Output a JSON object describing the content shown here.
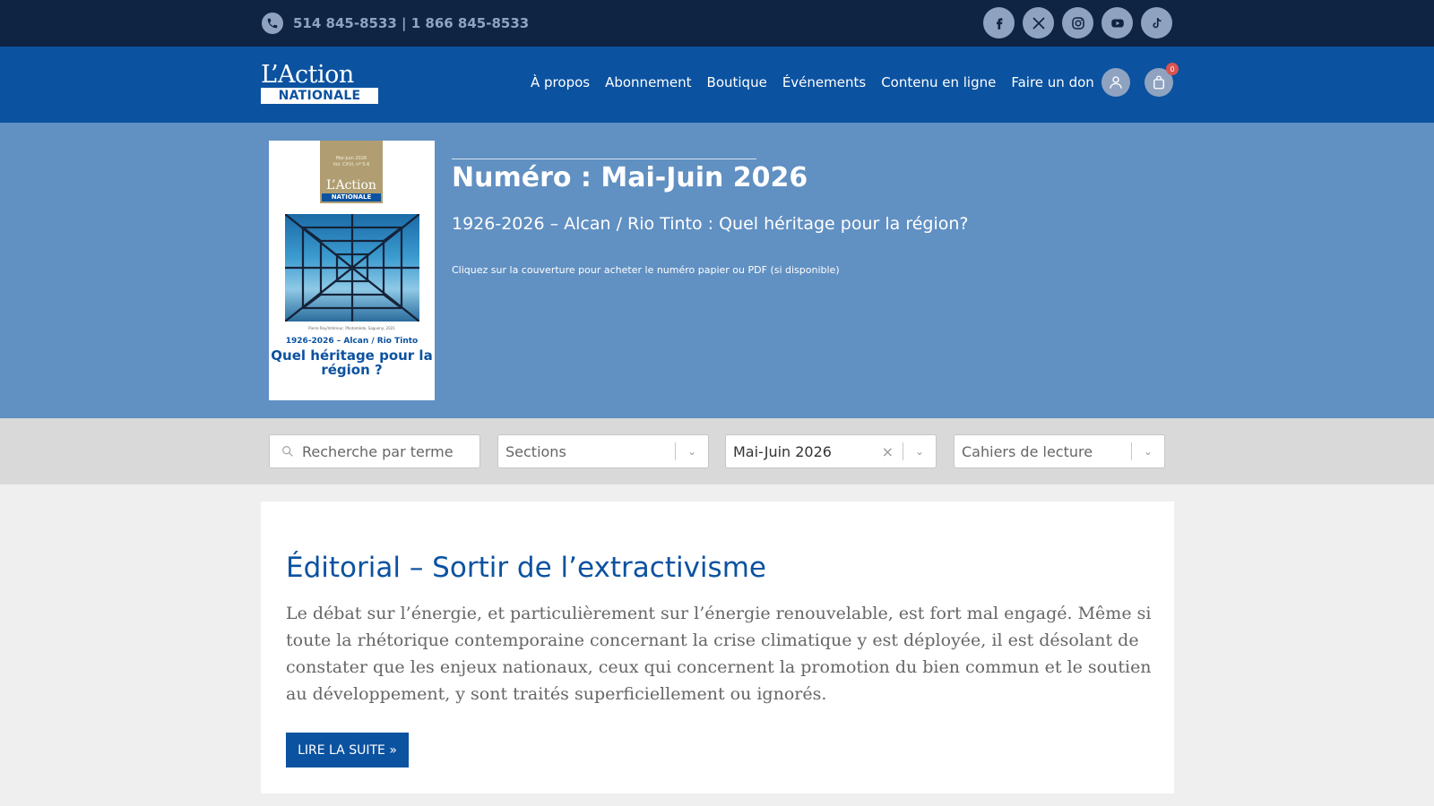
{
  "topbar": {
    "phone_text": "514 845-8533 | 1 866 845-8533",
    "socials": [
      "facebook-icon",
      "x-icon",
      "instagram-icon",
      "youtube-icon",
      "tiktok-icon"
    ]
  },
  "nav": {
    "logo_line1": "L’Action",
    "logo_line2": "NATIONALE",
    "items": [
      "À propos",
      "Abonnement",
      "Boutique",
      "Événements",
      "Contenu en ligne",
      "Faire un don"
    ],
    "cart_count": "0"
  },
  "hero": {
    "title": "Numéro : Mai-Juin 2026",
    "subtitle": "1926-2026 – Alcan / Rio Tinto : Quel héritage pour la région?",
    "note": "Cliquez sur la couverture pour acheter le numéro papier ou PDF (si disponible)",
    "cover": {
      "date": "Mai-Juin 2026",
      "volume": "Vol. CXVI, nº 5-6",
      "logo_line1": "L’Action",
      "logo_line2": "NATIONALE",
      "credit": "Pierre Roy/Intérieur, Photomède, Sagueny, 2021",
      "sub": "1926-2026 – Alcan / Rio Tinto",
      "title": "Quel héritage pour la région ?"
    }
  },
  "filters": {
    "search_placeholder": "Recherche par terme",
    "sections": "Sections",
    "issue": "Mai-Juin 2026",
    "cahiers": "Cahiers de lecture"
  },
  "article": {
    "title": "Éditorial – Sortir de l’extractivisme",
    "excerpt": "Le débat sur l’énergie, et particulièrement sur l’énergie renouvelable, est fort mal engagé. Même si toute la rhétorique contemporaine concernant la crise climatique y est déployée, il est désolant de constater que les enjeux nationaux, ceux qui concernent la promotion du bien commun et le soutien au développement, y sont traités superficiellement ou ignorés.",
    "button": "LIRE LA SUITE »"
  },
  "colors": {
    "topbar": "#0f2342",
    "nav": "#0b52a0",
    "hero": "#6190c2",
    "filters_bg": "#d9d9d9",
    "page_bg": "#efefef"
  }
}
